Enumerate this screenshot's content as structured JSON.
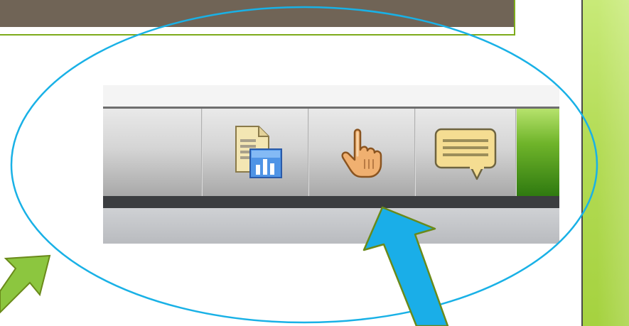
{
  "colors": {
    "annotation_ellipse": "#19b1e6",
    "blue_arrow": "#1aaee8",
    "green_arrow": "#8cc63f",
    "arrow_outline": "#6a8a1a",
    "top_panel": "#706456",
    "accent_green": "#a5d23f"
  },
  "toolbar": {
    "buttons": [
      {
        "icon": "report-chart-icon"
      },
      {
        "icon": "hand-pointer-icon"
      },
      {
        "icon": "comment-bubble-icon"
      }
    ]
  }
}
